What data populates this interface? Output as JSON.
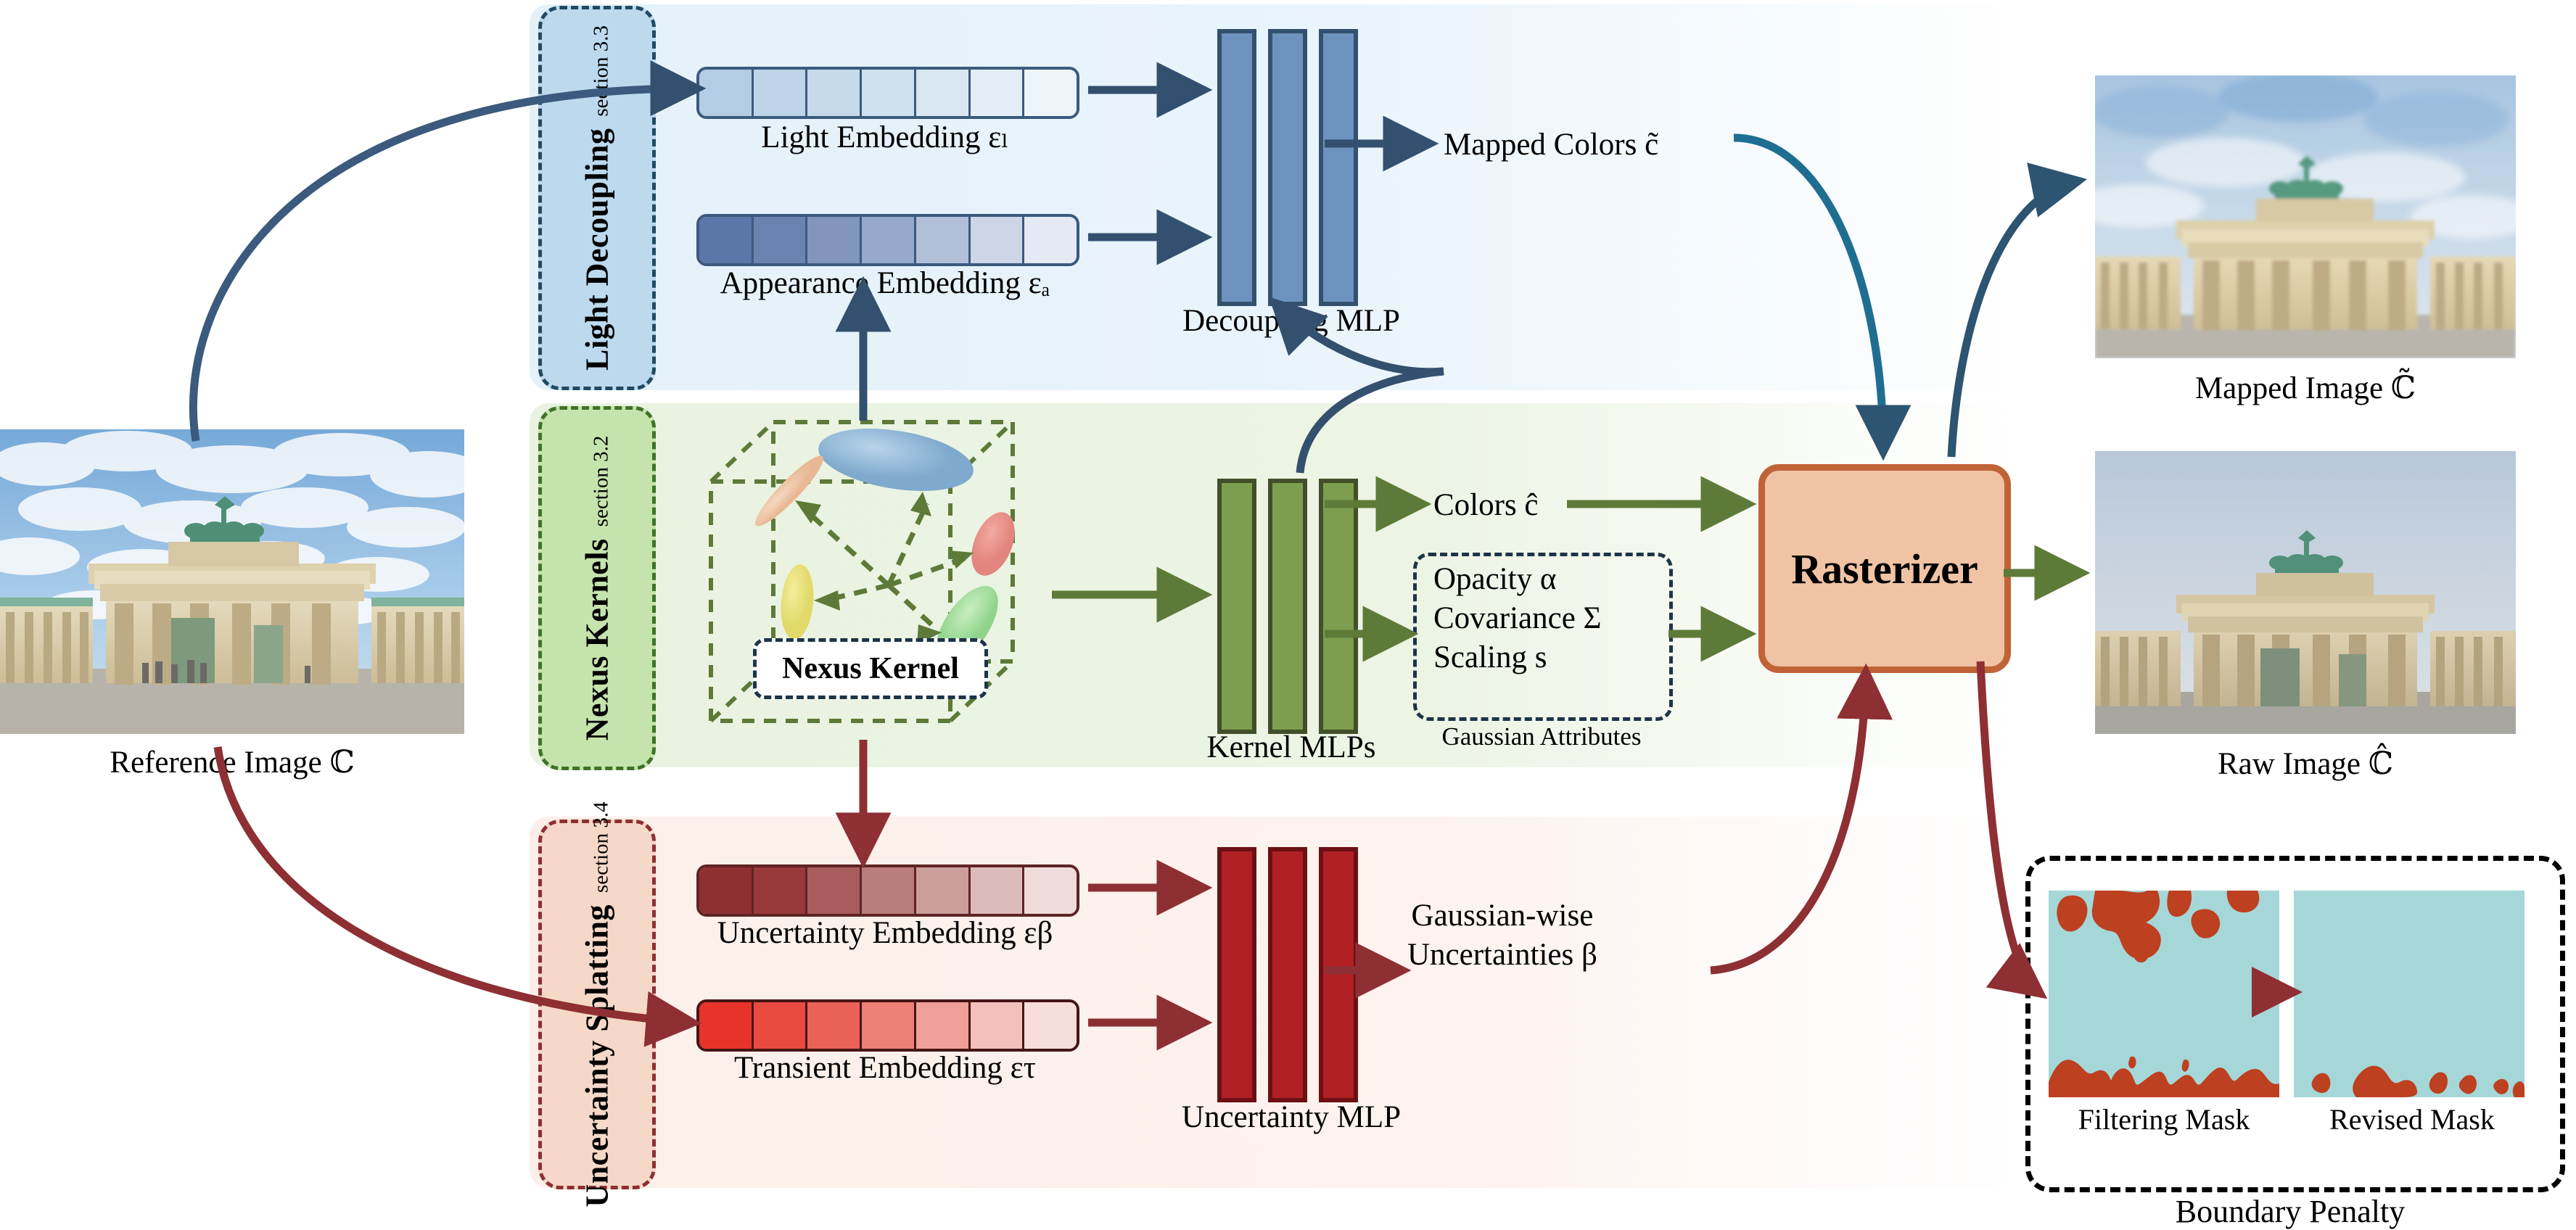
{
  "colors": {
    "blue_dark": "#33506e",
    "blue_mlp": "#6c92bd",
    "blue_band": "#e4f1fa",
    "green_dark": "#41502a",
    "green_mlp": "#7d9e4f",
    "green_band": "#e9f3e0",
    "green_dash": "#5d7a38",
    "red_dark": "#6d1013",
    "red_mlp": "#b01f24",
    "red_band": "#fcefe9",
    "red_arrow": "#8e2f33",
    "rasterizer_fill": "#f0c3a4",
    "rasterizer_border": "#c06337",
    "mask_bg": "#a5d7d8",
    "mask_blob": "#bd4020"
  },
  "sections": [
    {
      "id": "light-decoupling",
      "title": "Light Decoupling",
      "subtitle": "section 3.3"
    },
    {
      "id": "nexus-kernels",
      "title": "Nexus Kernels",
      "subtitle": "section 3.2"
    },
    {
      "id": "uncertainty-splatting",
      "title": "Uncertainty Splatting",
      "subtitle": "section 3.4"
    }
  ],
  "input": {
    "label": "Reference Image ℂ"
  },
  "light_decoupling": {
    "light_embedding_label": "Light Embedding εₗ",
    "appearance_embedding_label": "Appearance Embedding εₐ",
    "mlp_label": "Decoupling MLP",
    "output_label": "Mapped Colors c̃",
    "embedding_cells": 7
  },
  "nexus_kernels": {
    "kernel_pill_label": "Nexus Kernel",
    "mlp_label": "Kernel MLPs",
    "colors_label": "Colors ĉ",
    "attributes_title": "Gaussian Attributes",
    "attributes": [
      "Opacity α",
      "Covariance Σ",
      "Scaling s"
    ]
  },
  "uncertainty_splatting": {
    "uncertainty_embedding_label": "Uncertainty Embedding εβ",
    "transient_embedding_label": "Transient Embedding ετ",
    "mlp_label": "Uncertainty MLP",
    "output_label_line1": "Gaussian-wise",
    "output_label_line2": "Uncertainties β",
    "embedding_cells": 7
  },
  "rasterizer": {
    "label": "Rasterizer"
  },
  "outputs": [
    {
      "id": "mapped-image",
      "label": "Mapped Image ℂ̃"
    },
    {
      "id": "raw-image",
      "label": "Raw Image ℂ̂"
    }
  ],
  "boundary_penalty": {
    "title": "Boundary Penalty",
    "masks": [
      {
        "id": "filtering-mask",
        "label": "Filtering Mask"
      },
      {
        "id": "revised-mask",
        "label": "Revised Mask"
      }
    ]
  }
}
